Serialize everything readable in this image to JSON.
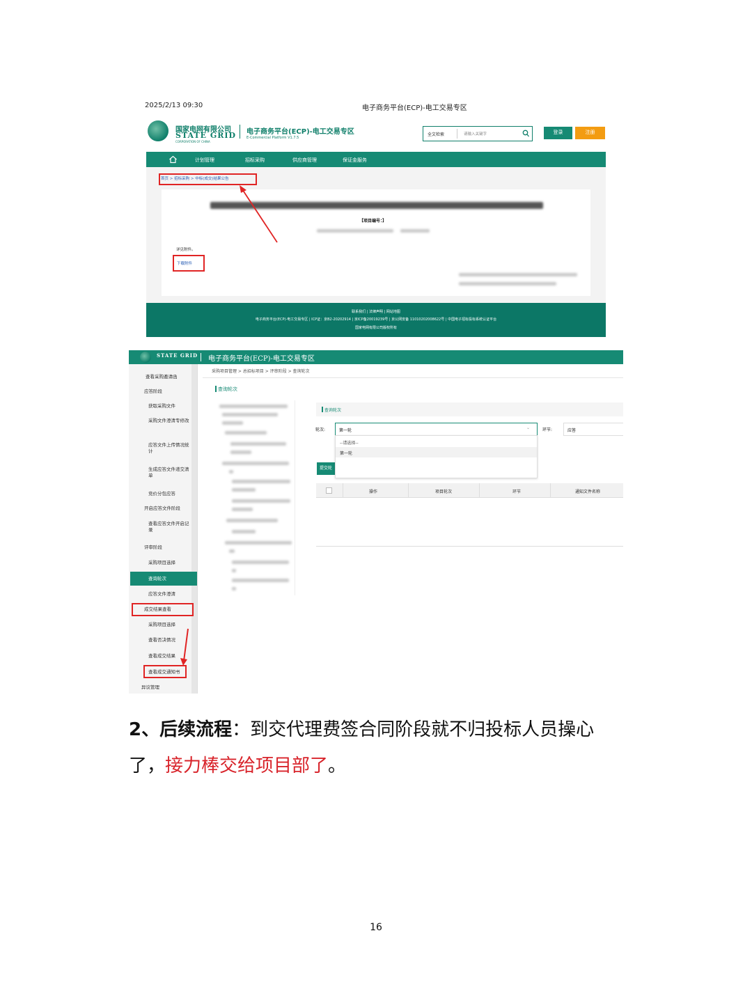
{
  "screenshot1": {
    "timestamp": "2025/2/13 09:30",
    "browser_title": "电子商务平台(ECP)-电工交易专区",
    "logo": {
      "cn": "国家电网有限公司",
      "en": "STATE GRID",
      "sub": "CORPORATION OF CHINA"
    },
    "site_title": "电子商务平台(ECP)-电工交易专区",
    "site_subtitle": "E-Commercial Platform V1.7.5",
    "search": {
      "scope": "全文检索",
      "placeholder": "请输入关键字"
    },
    "login_label": "登录",
    "register_label": "注册",
    "nav": [
      "计划管理",
      "招标采购",
      "供应商管理",
      "保证金服务"
    ],
    "breadcrumb": "首页 > 招标采购 > 中标(成交)结果公告",
    "project_no": "【项目编号：】",
    "see_attachment": "详见附件。",
    "download_label": "下载附件",
    "footer": {
      "links": "联系我们  |  法律声明  |  网站地图",
      "icp": "电子商务平台(ECP)-电工交易专区 | ICP证：京B2-20202914 | 京ICP备20019239号 | 京公网安备 11010202008622号 | 中国电子招标投标系统认证平台",
      "copyright": "国家电网有限公司版权所有"
    }
  },
  "screenshot2": {
    "header_title": "电子商务平台(ECP)-电工交易专区",
    "breadcrumb": "采购项目管理  >  总招标项目  >  评审阶段  >  查询轮次",
    "section_title": "查询轮次",
    "panel_title": "查询轮次",
    "round_label": "轮次:",
    "round_value": "第一轮",
    "dropdown_options": [
      "--请选择--",
      "第一轮"
    ],
    "stage_label": "环节:",
    "stage_value": "应答",
    "submit_label": "提交轮",
    "table_headers": [
      "操作",
      "项目轮次",
      "环节",
      "通知文件名称"
    ],
    "sidebar": [
      "查看采购邀请函",
      "应答阶段",
      "获取采购文件",
      "采购文件澄清专修改",
      "应答文件上传情况统计",
      "生成应答文件递交清单",
      "竞价分包应答",
      "开启应答文件阶段",
      "查看应答文件开启记录",
      "评审阶段",
      "采购项目选择",
      "查询轮次",
      "应答文件澄清",
      "成交结果查看",
      "采购项目选择",
      "查看否决情况",
      "查看成交结果",
      "查看成交通知书",
      "异议管理"
    ]
  },
  "caption": {
    "number": "2、",
    "heading": "后续流程",
    "colon": "：",
    "text_part1": "到交代理费签合同阶段就不归投标人员操心",
    "text_part2": "了，",
    "highlight": "接力棒交给项目部了",
    "period": "。"
  },
  "page_number": "16",
  "colors": {
    "brand_green": "#168a74",
    "red": "#e02424",
    "orange": "#f39c12"
  }
}
